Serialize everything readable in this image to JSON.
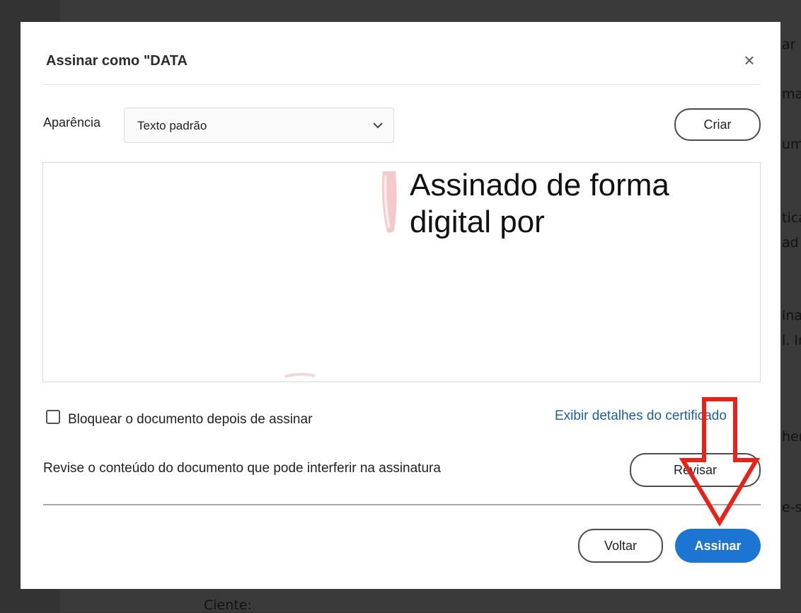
{
  "background_document": {
    "fragments": [
      "ar",
      "ma",
      "um",
      "tica",
      "ad",
      "ina",
      "l. Ir",
      "hen",
      "e-s",
      "Ciente:"
    ]
  },
  "dialog": {
    "title": "Assinar como \"DATA",
    "close_symbol": "×",
    "appearance": {
      "label": "Aparência",
      "selected": "Texto padrão",
      "create_button": "Criar"
    },
    "preview": {
      "text": "Assinado de forma digital por"
    },
    "lock_checkbox": {
      "label": "Bloquear o documento depois de assinar",
      "checked": false
    },
    "certificate_link": "Exibir detalhes do certificado",
    "review": {
      "text": "Revise o conteúdo do documento que pode interferir na assinatura",
      "button": "Revisar"
    },
    "footer": {
      "back_button": "Voltar",
      "sign_button": "Assinar"
    }
  },
  "colors": {
    "primary_button": "#1c74d3",
    "link": "#1b5fa8",
    "annotation_arrow": "#e8211b"
  },
  "icons": [
    "close-icon",
    "chevron-down-icon",
    "checkbox-icon",
    "down-arrow-annotation"
  ]
}
